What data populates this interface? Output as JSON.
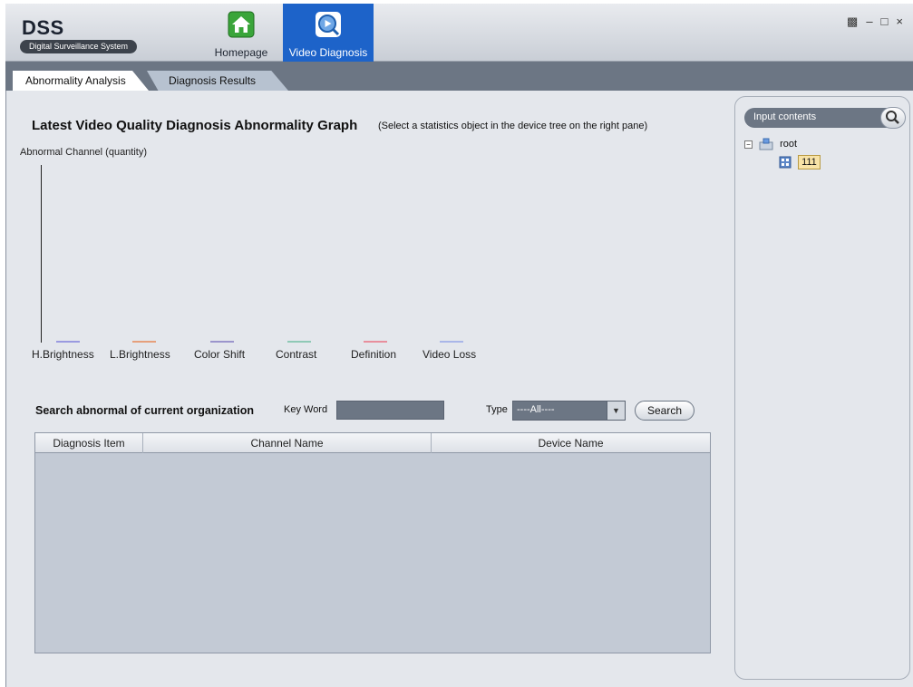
{
  "app": {
    "title": "DSS",
    "subtitle": "Digital Surveillance System"
  },
  "nav": {
    "home_label": "Homepage",
    "video_label": "Video Diagnosis"
  },
  "window_controls": [
    "lock-icon",
    "minimize-icon",
    "maximize-icon",
    "close-icon"
  ],
  "tabs": [
    {
      "label": "Abnormality Analysis",
      "active": true
    },
    {
      "label": "Diagnosis Results",
      "active": false
    }
  ],
  "graph": {
    "title": "Latest Video Quality Diagnosis Abnormality Graph",
    "hint": "(Select a statistics object in the device tree on the right pane)",
    "y_label": "Abnormal Channel (quantity)"
  },
  "chart_data": {
    "type": "bar",
    "categories": [
      "H.Brightness",
      "L.Brightness",
      "Color Shift",
      "Contrast",
      "Definition",
      "Video Loss"
    ],
    "values": [
      0,
      0,
      0,
      0,
      0,
      0
    ],
    "ylabel": "Abnormal Channel (quantity)",
    "colors": [
      "#9a9ae0",
      "#e6a07c",
      "#9b95cc",
      "#8fc9b6",
      "#e88f9d",
      "#a9b6e8"
    ]
  },
  "search": {
    "title": "Search abnormal of current organization",
    "keyword_label": "Key Word",
    "keyword_value": "",
    "type_label": "Type",
    "type_value": "----All----",
    "button_label": "Search"
  },
  "table": {
    "columns": [
      "Diagnosis Item",
      "Channel Name",
      "Device Name"
    ],
    "rows": []
  },
  "tree": {
    "search_placeholder": "Input contents",
    "root_label": "root",
    "child_label": "111"
  }
}
